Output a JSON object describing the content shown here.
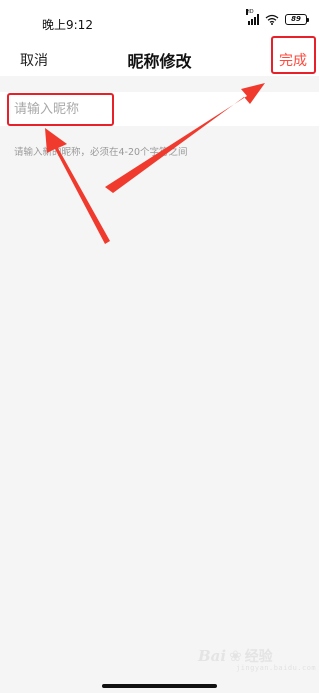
{
  "status_bar": {
    "time": "晚上9:12",
    "signal_tag": "HD",
    "battery": "89",
    "icons": [
      "signal-icon",
      "wifi-icon",
      "battery-icon"
    ]
  },
  "nav": {
    "cancel_label": "取消",
    "title": "昵称修改",
    "done_label": "完成",
    "done_color": "#ff4a3d"
  },
  "form": {
    "nickname_placeholder": "请输入昵称",
    "nickname_value": "",
    "hint": "请输入新的昵称，必须在4-20个字符之间"
  },
  "annotations": {
    "highlight_color": "#e8202a",
    "arrow_color": "#f03a2e"
  },
  "watermark": {
    "brand": "Bai",
    "brand_cn": "经验",
    "sub": "jingyan.baidu.com"
  }
}
